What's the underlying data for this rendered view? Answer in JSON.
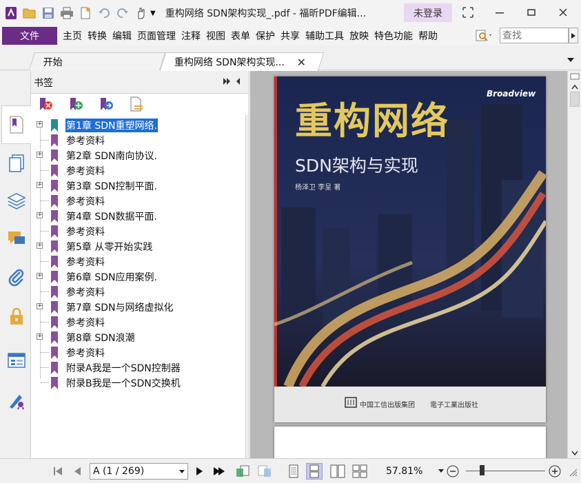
{
  "window": {
    "title": "重构网络 SDN架构实现_.pdf - 福昕PDF编辑...",
    "login_label": "未登录"
  },
  "menu": {
    "file_label": "文件",
    "items": [
      "主页",
      "转换",
      "编辑",
      "页面管理",
      "注释",
      "视图",
      "表单",
      "保护",
      "共享",
      "辅助工具",
      "放映",
      "特色功能",
      "帮助"
    ],
    "search_placeholder": "查找"
  },
  "tabs": [
    {
      "label": "开始"
    },
    {
      "label": "重构网络 SDN架构实现..."
    }
  ],
  "bookmarks": {
    "panel_title": "书签",
    "items": [
      {
        "label": "第1章 SDN重塑网络.",
        "expandable": true,
        "selected": true
      },
      {
        "label": "参考资料",
        "expandable": false
      },
      {
        "label": "第2章 SDN南向协议.",
        "expandable": true
      },
      {
        "label": "参考资料",
        "expandable": false
      },
      {
        "label": "第3章 SDN控制平面.",
        "expandable": true
      },
      {
        "label": "参考资料",
        "expandable": false
      },
      {
        "label": "第4章 SDN数据平面.",
        "expandable": true
      },
      {
        "label": "参考资料",
        "expandable": false
      },
      {
        "label": "第5章 从零开始实践",
        "expandable": true
      },
      {
        "label": "参考资料",
        "expandable": false
      },
      {
        "label": "第6章 SDN应用案例.",
        "expandable": true
      },
      {
        "label": "参考资料",
        "expandable": false
      },
      {
        "label": "第7章 SDN与网络虚拟化",
        "expandable": true
      },
      {
        "label": "参考资料",
        "expandable": false
      },
      {
        "label": "第8章 SDN浪潮",
        "expandable": true
      },
      {
        "label": "参考资料",
        "expandable": false
      },
      {
        "label": "附录A我是一个SDN控制器",
        "expandable": false
      },
      {
        "label": "附录B我是一个SDN交换机",
        "expandable": false
      }
    ]
  },
  "cover": {
    "title": "重构网络",
    "subtitle": "SDN架构与实现",
    "authors": "杨泽卫  李呈  著",
    "brand": "Broadview",
    "publisher1": "中国工信出版集团",
    "publisher2": "電子工業出版社"
  },
  "status": {
    "page_indicator": "A (1 / 269)",
    "zoom": "57.81%",
    "zoom_level": 0.2
  },
  "colors": {
    "accent": "#6a2c84",
    "selection": "#1e6fd6",
    "bookmark_flag": "#8b4f9e",
    "bookmark_flag_selected": "#2a8c8c"
  }
}
